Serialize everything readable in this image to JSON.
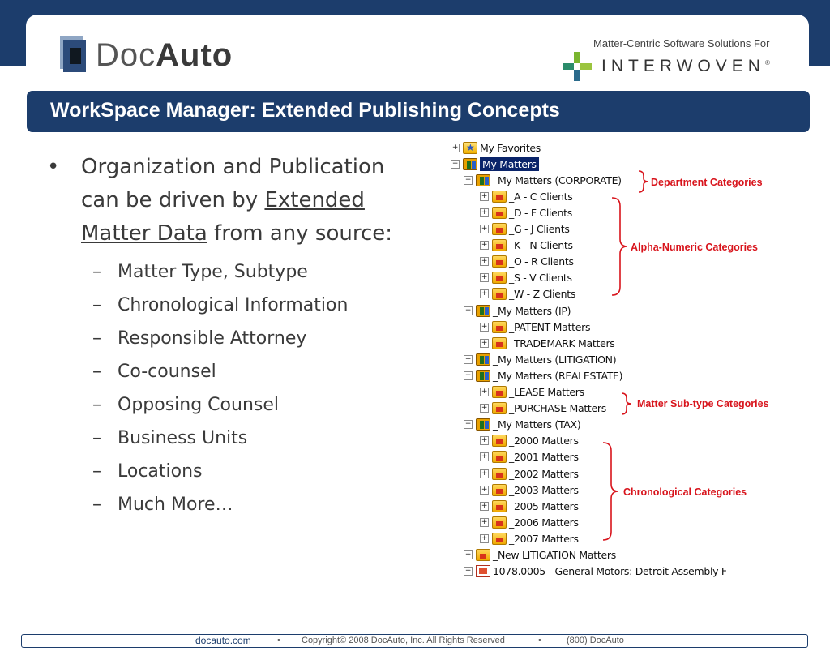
{
  "header": {
    "logo_left": {
      "name_part1": "Doc",
      "name_part2": "Auto"
    },
    "logo_right": {
      "tagline": "Matter-Centric Software Solutions For",
      "brand": "INTERWOVEN",
      "tm": "®"
    }
  },
  "title": "WorkSpace Manager: Extended Publishing Concepts",
  "content": {
    "bullet_symbol": "•",
    "dash_symbol": "–",
    "main_point": {
      "text_before": "Organization and Publication can be driven by ",
      "underlined": "Extended Matter Data",
      "text_after": " from any source:"
    },
    "sub_points": [
      "Matter Type, Subtype",
      "Chronological Information",
      "Responsible Attorney",
      "Co-counsel",
      "Opposing Counsel",
      "Business Units",
      "Locations",
      "Much More…"
    ]
  },
  "tree": {
    "nodes": [
      {
        "label": "My Favorites",
        "icon": "favorites-folder-icon",
        "expander": "+"
      },
      {
        "label": "My Matters",
        "icon": "matters-icon",
        "expander": "−",
        "selected": true
      },
      {
        "label": "_My Matters (CORPORATE)",
        "icon": "matters-icon",
        "expander": "−"
      },
      {
        "label": "_A - C Clients",
        "icon": "folder-icon",
        "expander": "+"
      },
      {
        "label": "_D - F Clients",
        "icon": "folder-icon",
        "expander": "+"
      },
      {
        "label": "_G - J Clients",
        "icon": "folder-icon",
        "expander": "+"
      },
      {
        "label": "_K - N Clients",
        "icon": "folder-icon",
        "expander": "+"
      },
      {
        "label": "_O - R Clients",
        "icon": "folder-icon",
        "expander": "+"
      },
      {
        "label": "_S - V Clients",
        "icon": "folder-icon",
        "expander": "+"
      },
      {
        "label": "_W - Z Clients",
        "icon": "folder-icon",
        "expander": "+"
      },
      {
        "label": "_My Matters (IP)",
        "icon": "matters-icon",
        "expander": "−"
      },
      {
        "label": "_PATENT Matters",
        "icon": "folder-icon",
        "expander": "+"
      },
      {
        "label": "_TRADEMARK Matters",
        "icon": "folder-icon",
        "expander": "+"
      },
      {
        "label": "_My Matters (LITIGATION)",
        "icon": "matters-icon",
        "expander": "+"
      },
      {
        "label": "_My Matters (REALESTATE)",
        "icon": "matters-icon",
        "expander": "−"
      },
      {
        "label": "_LEASE Matters",
        "icon": "folder-icon",
        "expander": "+"
      },
      {
        "label": "_PURCHASE Matters",
        "icon": "folder-icon",
        "expander": "+"
      },
      {
        "label": "_My Matters (TAX)",
        "icon": "matters-icon",
        "expander": "−"
      },
      {
        "label": "_2000 Matters",
        "icon": "folder-icon",
        "expander": "+"
      },
      {
        "label": "_2001 Matters",
        "icon": "folder-icon",
        "expander": "+"
      },
      {
        "label": "_2002 Matters",
        "icon": "folder-icon",
        "expander": "+"
      },
      {
        "label": "_2003 Matters",
        "icon": "folder-icon",
        "expander": "+"
      },
      {
        "label": "_2005 Matters",
        "icon": "folder-icon",
        "expander": "+"
      },
      {
        "label": "_2006 Matters",
        "icon": "folder-icon",
        "expander": "+"
      },
      {
        "label": "_2007 Matters",
        "icon": "folder-icon",
        "expander": "+"
      },
      {
        "label": "_New LITIGATION Matters",
        "icon": "folder-icon",
        "expander": "+"
      },
      {
        "label": "1078.0005 - General Motors: Detroit Assembly F",
        "icon": "matter-document-icon",
        "expander": "+"
      }
    ],
    "annotations": [
      "Department Categories",
      "Alpha-Numeric  Categories",
      "Matter Sub-type Categories",
      "Chronological Categories"
    ]
  },
  "footer": {
    "site": "docauto.com",
    "separator": "•",
    "copyright": "Copyright© 2008 DocAuto, Inc.  All Rights Reserved",
    "phone": "(800) DocAuto"
  },
  "colors": {
    "navy": "#1c3d6c",
    "annotation_red": "#d8141c",
    "body_text": "#3a3a3a",
    "selection": "#0a246a"
  }
}
